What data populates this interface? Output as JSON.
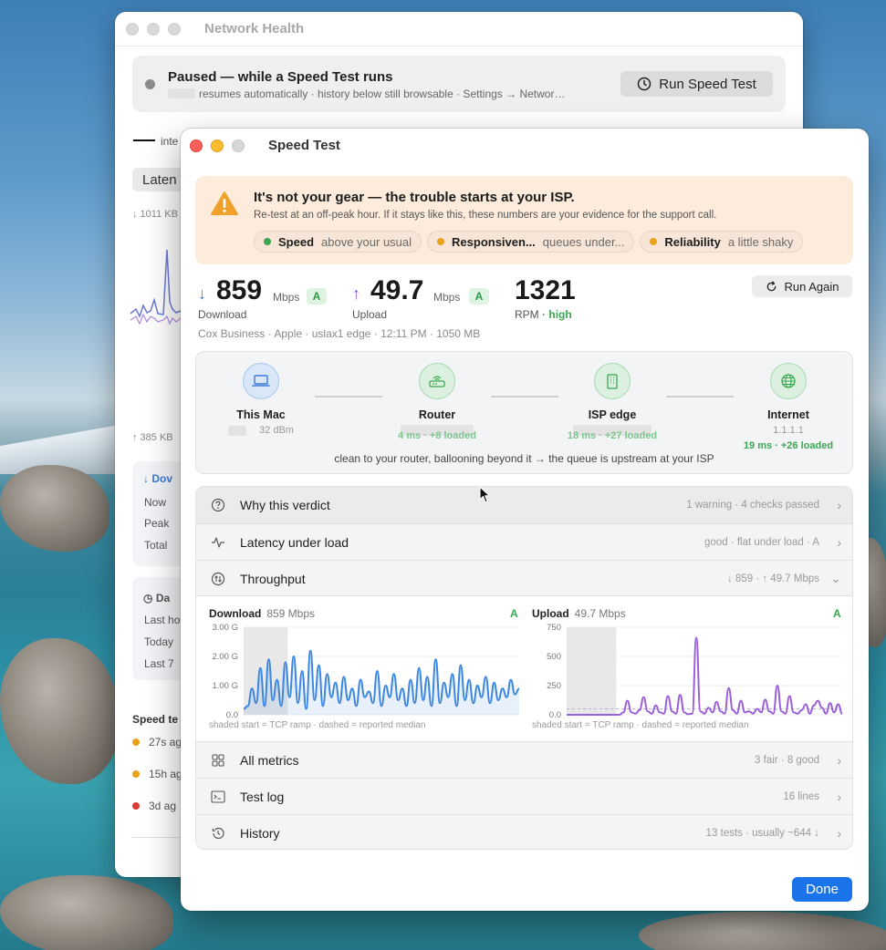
{
  "back_window": {
    "title": "Network Health",
    "paused": {
      "title": "Paused — while a Speed Test runs",
      "subtitle": "resumes automatically · history below still browsable · Settings → Networ…",
      "button_label": "Run Speed Test"
    },
    "side": {
      "legend_fragment": "inte",
      "chip_fragment": "Laten",
      "top_axis_fragment": "↓ 1011 KB",
      "bottom_axis_fragment": "↑ 385 KB",
      "card1_fragment": "Dov",
      "card1_rows": [
        "Now",
        "Peak",
        "Total"
      ],
      "card2_fragment": "Da",
      "card2_rows": [
        "Last ho",
        "Today",
        "Last 7"
      ],
      "speed_tests_fragment": "Speed te",
      "speed_tests": [
        {
          "time": "27s ag",
          "color": "#e8a21a"
        },
        {
          "time": "15h ag",
          "color": "#e8a21a"
        },
        {
          "time": "3d ag",
          "color": "#d93a33"
        }
      ]
    }
  },
  "front_window": {
    "title": "Speed Test",
    "alert": {
      "title": "It's not your gear — the trouble starts at your ISP.",
      "subtitle": "Re-test at an off-peak hour. If it stays like this, these numbers are your evidence for the support call.",
      "pills": [
        {
          "label": "Speed",
          "value": "above your usual",
          "color": "#3aa752"
        },
        {
          "label": "Responsiven...",
          "value": "queues under...",
          "color": "#e8a21a"
        },
        {
          "label": "Reliability",
          "value": "a little shaky",
          "color": "#e8a21a"
        }
      ]
    },
    "download": {
      "arrow": "↓",
      "value": "859",
      "unit": "Mbps",
      "grade": "A",
      "label": "Download"
    },
    "upload": {
      "arrow": "↑",
      "value": "49.7",
      "unit": "Mbps",
      "grade": "A",
      "label": "Upload"
    },
    "rpm": {
      "value": "1321",
      "label": "RPM",
      "quality": "high"
    },
    "run_again_label": "Run Again",
    "provider_line": "Cox Business · Apple · uslax1 edge · 12:11 PM · 1050 MB",
    "path": {
      "nodes": [
        {
          "label": "This Mac",
          "sub": "32 dBm",
          "sub2": ""
        },
        {
          "label": "Router",
          "sub": "",
          "sub2": "4 ms · +8 loaded"
        },
        {
          "label": "ISP edge",
          "sub": "",
          "sub2": "18 ms · +27 loaded"
        },
        {
          "label": "Internet",
          "sub": "1.1.1.1",
          "sub2": "19 ms · +26 loaded"
        }
      ],
      "caption": "clean to your router, ballooning beyond it → the queue is upstream at your ISP"
    },
    "rows": {
      "why": {
        "label": "Why this verdict",
        "meta": "1 warning · 4 checks passed"
      },
      "latency": {
        "label": "Latency under load",
        "meta": "good · flat under load · A"
      },
      "throughput": {
        "label": "Throughput",
        "meta": "↓ 859 · ↑ 49.7 Mbps"
      },
      "all_metrics": {
        "label": "All metrics",
        "meta": "3 fair · 8 good"
      },
      "test_log": {
        "label": "Test log",
        "meta": "16 lines"
      },
      "history": {
        "label": "History",
        "meta": "13 tests · usually ~644 ↓"
      }
    },
    "download_chart": {
      "title": "Download",
      "value": "859 Mbps",
      "grade": "A",
      "footnote": "shaded start = TCP ramp · dashed = reported median"
    },
    "upload_chart": {
      "title": "Upload",
      "value": "49.7 Mbps",
      "grade": "A",
      "footnote": "shaded start = TCP ramp · dashed = reported median"
    },
    "done_label": "Done"
  },
  "chart_data": [
    {
      "type": "line",
      "title": "Download",
      "ylabel": "",
      "yticks": [
        "0.0",
        "1.00 G",
        "2.00 G",
        "3.00 G"
      ],
      "ylim": [
        0,
        3.0
      ],
      "series": [
        {
          "values": [
            0.2,
            0.3,
            0.9,
            0.4,
            1.6,
            0.3,
            1.9,
            0.5,
            1.2,
            0.3,
            1.8,
            0.6,
            2.0,
            0.4,
            1.5,
            0.2,
            2.2,
            0.5,
            1.7,
            0.3,
            1.4,
            0.6,
            1.1,
            0.4,
            1.3,
            0.5,
            0.9,
            0.3,
            1.2,
            0.6,
            0.8,
            0.4,
            1.5,
            0.3,
            1.0,
            0.6,
            1.4,
            0.5,
            0.9,
            0.3,
            1.2,
            0.4,
            1.6,
            0.5,
            1.3,
            0.3,
            1.9,
            0.4,
            1.1,
            0.6,
            1.4,
            0.3,
            1.7,
            0.5,
            1.2,
            0.4,
            1.0,
            0.6,
            1.3,
            0.4,
            1.1,
            0.5,
            0.9,
            0.6,
            1.2,
            0.7,
            0.9
          ]
        }
      ],
      "ramp_fraction": 0.16
    },
    {
      "type": "line",
      "title": "Upload",
      "ylabel": "",
      "yticks": [
        "0.0",
        "250",
        "500",
        "750"
      ],
      "ylim": [
        0,
        750
      ],
      "median": 50,
      "series": [
        {
          "values": [
            0,
            0,
            0,
            0,
            0,
            0,
            0,
            0,
            0,
            0,
            0,
            0,
            0,
            0,
            20,
            120,
            20,
            10,
            40,
            150,
            30,
            10,
            80,
            20,
            10,
            160,
            30,
            10,
            170,
            20,
            5,
            10,
            660,
            30,
            10,
            60,
            20,
            110,
            30,
            10,
            230,
            40,
            10,
            120,
            20,
            30,
            10,
            50,
            20,
            130,
            30,
            10,
            250,
            30,
            10,
            160,
            20,
            10,
            40,
            90,
            10,
            80,
            120,
            60,
            10,
            100,
            20,
            90,
            10
          ]
        }
      ],
      "ramp_fraction": 0.18
    }
  ]
}
